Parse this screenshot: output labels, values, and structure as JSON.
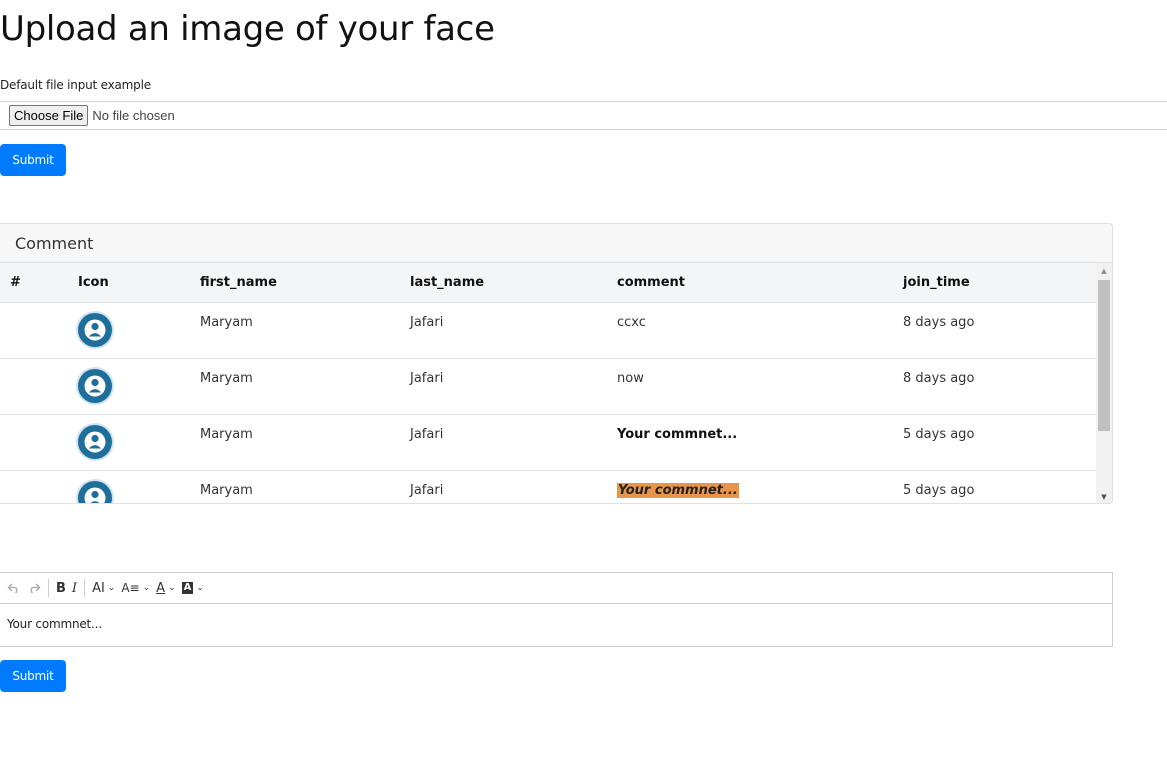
{
  "page": {
    "title": "Upload an image of your face"
  },
  "upload": {
    "label": "Default file input example",
    "choose_label": "Choose File",
    "status": "No file chosen",
    "submit_label": "Submit"
  },
  "comments_card": {
    "header": "Comment",
    "columns": [
      "#",
      "Icon",
      "first_name",
      "last_name",
      "comment",
      "join_time"
    ],
    "rows": [
      {
        "first_name": "Maryam",
        "last_name": "Jafari",
        "comment": "ccxc",
        "join_time": "8 days ago",
        "icon": "user-avatar-icon"
      },
      {
        "first_name": "Maryam",
        "last_name": "Jafari",
        "comment": "now",
        "join_time": "8 days ago",
        "icon": "user-avatar-icon"
      },
      {
        "first_name": "Maryam",
        "last_name": "Jafari",
        "comment": "Your commnet...",
        "join_time": "5 days ago",
        "icon": "user-avatar-icon",
        "style": "bold"
      },
      {
        "first_name": "Maryam",
        "last_name": "Jafari",
        "comment": "Your commnet...",
        "join_time": "5 days ago",
        "icon": "user-avatar-icon",
        "style": "bold-italic-highlight",
        "highlight_color": "#e8954a"
      }
    ]
  },
  "editor": {
    "toolbar": {
      "undo_icon": "undo-icon",
      "redo_icon": "redo-icon",
      "bold": "B",
      "italic": "I",
      "font_size": "AI",
      "font_family": "A≡",
      "font_color": "A",
      "bg_color": "A"
    },
    "content": "Your commnet...",
    "submit_label": "Submit"
  },
  "colors": {
    "primary": "#007bff",
    "avatar": "#1e6e9c",
    "highlight": "#e8954a"
  }
}
